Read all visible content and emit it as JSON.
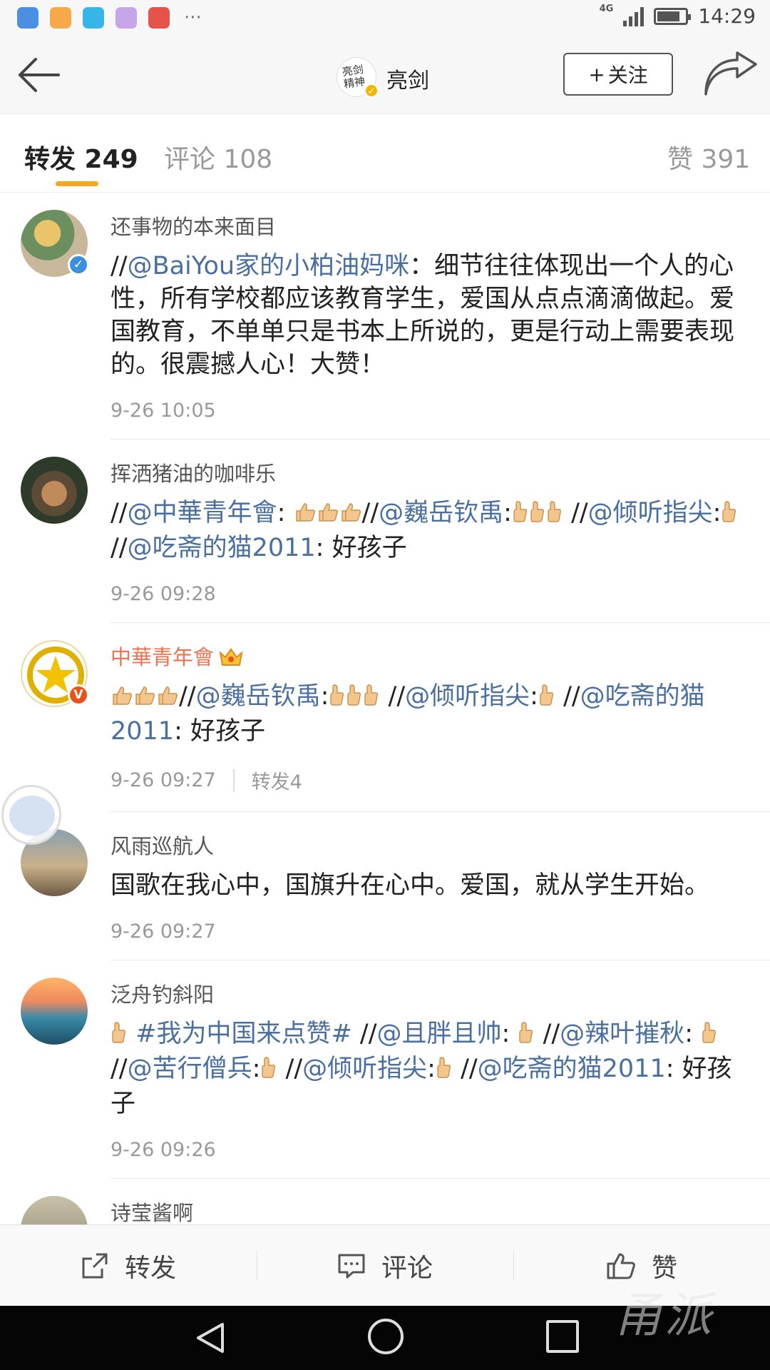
{
  "status_bar": {
    "network": "4G",
    "time": "14:29",
    "more": "···"
  },
  "header": {
    "title": "亮剑",
    "avatar_text": "亮剑\n精神",
    "follow_label": "关注",
    "follow_plus": "+"
  },
  "tabs": {
    "repost": "转发 249",
    "comment": "评论 108",
    "like": "赞 391"
  },
  "posts": [
    {
      "username": "还事物的本来面目",
      "content": [
        {
          "t": "//"
        },
        {
          "t": "@BaiYou家的小柏油妈咪",
          "link": true
        },
        {
          "t": "：细节往往体现出一个人的心性，所有学校都应该教育学生，爱国从点点滴滴做起。爱国教育，不单单只是书本上所说的，更是行动上需要表现的。很震撼人心！大赞！"
        }
      ],
      "time": "9-26 10:05"
    },
    {
      "username": "挥洒猪油的咖啡乐",
      "content": [
        {
          "t": "//"
        },
        {
          "t": "@中華青年會",
          "link": true
        },
        {
          "t": ": "
        },
        {
          "icon": "thumbs-up-icon",
          "n": 3
        },
        {
          "t": "//"
        },
        {
          "t": "@巍岳钦禹",
          "link": true
        },
        {
          "t": ":"
        },
        {
          "icon": "thumbs-up-small-icon",
          "n": 3
        },
        {
          "t": " //"
        },
        {
          "t": "@倾听指尖",
          "link": true
        },
        {
          "t": ":"
        },
        {
          "icon": "thumbs-up-small-icon",
          "n": 1
        },
        {
          "t": " //"
        },
        {
          "t": "@吃斋的猫2011",
          "link": true
        },
        {
          "t": ": 好孩子"
        }
      ],
      "time": "9-26 09:28"
    },
    {
      "username": "中華青年會",
      "orange": true,
      "crown": true,
      "content": [
        {
          "icon": "thumbs-up-icon",
          "n": 3
        },
        {
          "t": "//"
        },
        {
          "t": "@巍岳钦禹",
          "link": true
        },
        {
          "t": ":"
        },
        {
          "icon": "thumbs-up-small-icon",
          "n": 3
        },
        {
          "t": " //"
        },
        {
          "t": "@倾听指尖",
          "link": true
        },
        {
          "t": ":"
        },
        {
          "icon": "thumbs-up-small-icon",
          "n": 1
        },
        {
          "t": " //"
        },
        {
          "t": "@吃斋的猫2011",
          "link": true
        },
        {
          "t": ": 好孩子"
        }
      ],
      "time": "9-26 09:27",
      "reposts": "转发4"
    },
    {
      "username": "风雨巡航人",
      "content": [
        {
          "t": "国歌在我心中，国旗升在心中。爱国，就从学生开始。"
        }
      ],
      "time": "9-26 09:27"
    },
    {
      "username": "泛舟钓斜阳",
      "content": [
        {
          "icon": "thumbs-up-small-icon",
          "n": 1
        },
        {
          "t": " "
        },
        {
          "t": "#我为中国来点赞#",
          "link": true
        },
        {
          "t": " //"
        },
        {
          "t": "@且胖且帅",
          "link": true
        },
        {
          "t": ": "
        },
        {
          "icon": "thumbs-up-small-icon",
          "n": 1
        },
        {
          "t": " //"
        },
        {
          "t": "@辣叶摧秋",
          "link": true
        },
        {
          "t": ": "
        },
        {
          "icon": "thumbs-up-small-icon",
          "n": 1
        },
        {
          "t": " //"
        },
        {
          "t": "@苦行僧兵",
          "link": true
        },
        {
          "t": ":"
        },
        {
          "icon": "thumbs-up-small-icon",
          "n": 1
        },
        {
          "t": " //"
        },
        {
          "t": "@倾听指尖",
          "link": true
        },
        {
          "t": ":"
        },
        {
          "icon": "thumbs-up-small-icon",
          "n": 1
        },
        {
          "t": " //"
        },
        {
          "t": "@吃斋的猫2011",
          "link": true
        },
        {
          "t": ": 好孩子"
        }
      ],
      "time": "9-26 09:26"
    },
    {
      "username": "诗莹酱啊",
      "content": [],
      "time": ""
    }
  ],
  "actions": {
    "repost": "转发",
    "comment": "评论",
    "like": "赞"
  },
  "watermark": "甬派",
  "colors": {
    "link": "#4a6fa1",
    "orange_name": "#eb7350",
    "tab_underline": "#f5a623",
    "verified_blue": "#3b8fe0",
    "verified_orange": "#e8531d"
  }
}
